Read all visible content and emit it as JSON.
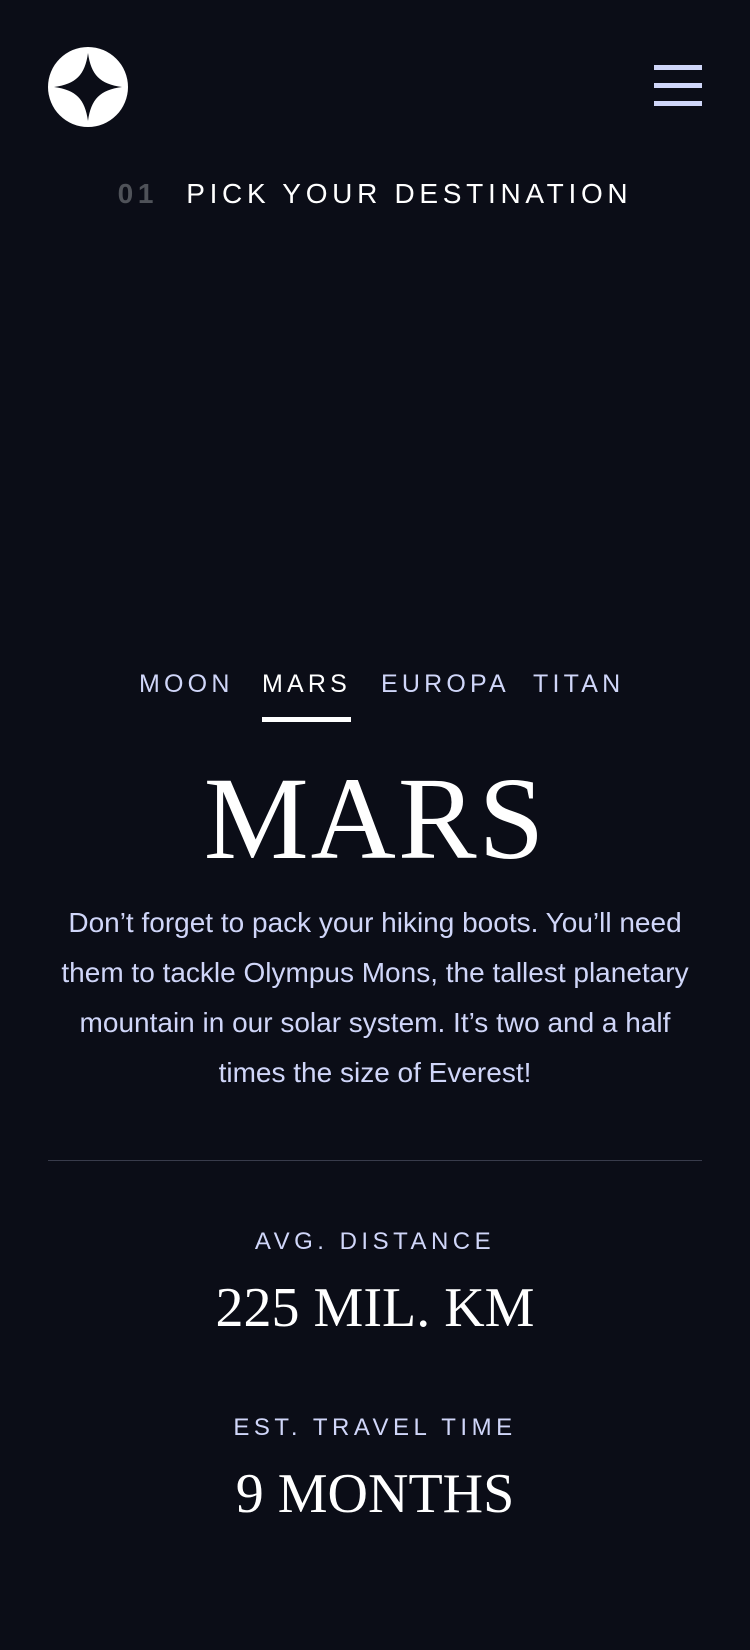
{
  "header": {
    "logo": "star-logo",
    "menu_icon": "hamburger-menu-icon"
  },
  "eyebrow": {
    "number": "01",
    "title": "PICK YOUR DESTINATION"
  },
  "planet_image": "mars-planet",
  "tabs": [
    {
      "label": "MOON",
      "active": false
    },
    {
      "label": "MARS",
      "active": true
    },
    {
      "label": "EUROPA",
      "active": false
    },
    {
      "label": "TITAN",
      "active": false
    }
  ],
  "destination": {
    "name": "MARS",
    "description": "Don’t forget to pack your hiking boots. You’ll need them to tackle Olympus Mons, the tallest planetary mountain in our solar system. It’s two and a half times the size of Everest!"
  },
  "stats": {
    "distance": {
      "label": "AVG. DISTANCE",
      "value": "225 MIL. KM"
    },
    "travel": {
      "label": "EST. TRAVEL TIME",
      "value": "9 MONTHS"
    }
  },
  "colors": {
    "background": "#0b0d17",
    "text": "#ffffff",
    "accent": "#d0d6f9",
    "muted": "#4f5259",
    "divider": "#383b4b"
  }
}
